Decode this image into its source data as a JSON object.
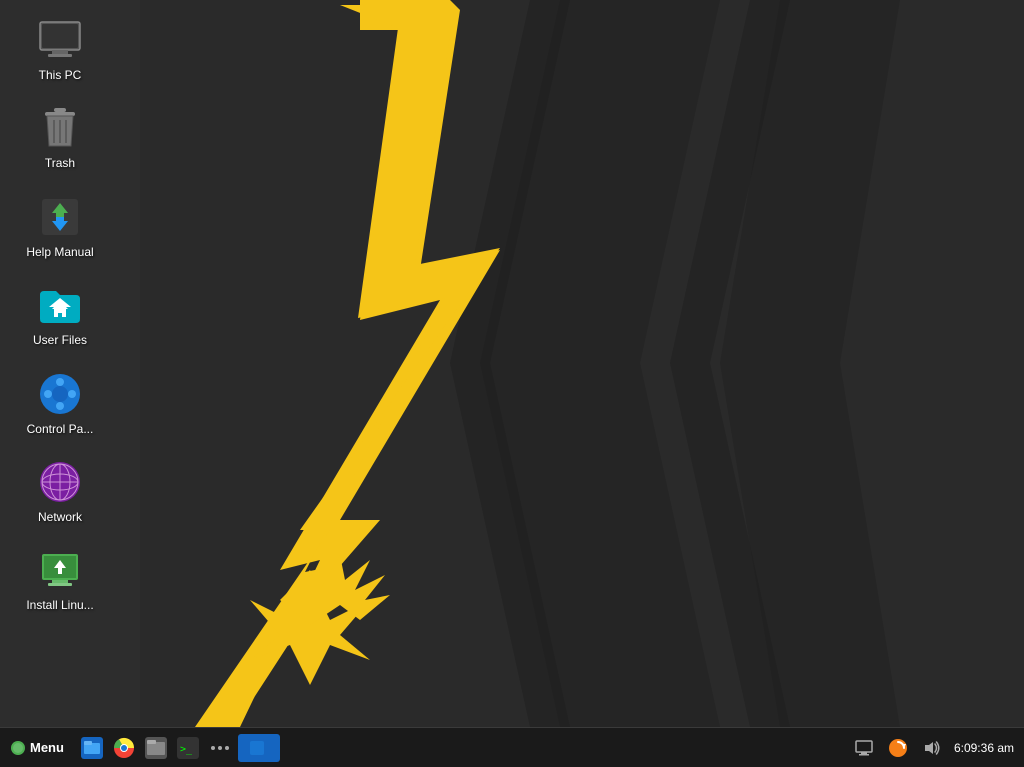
{
  "desktop": {
    "icons": [
      {
        "id": "this-pc",
        "label": "This PC",
        "icon_type": "computer"
      },
      {
        "id": "trash",
        "label": "Trash",
        "icon_type": "trash"
      },
      {
        "id": "help-manual",
        "label": "Help Manual",
        "icon_type": "help"
      },
      {
        "id": "user-files",
        "label": "User Files",
        "icon_type": "folder"
      },
      {
        "id": "control-panel",
        "label": "Control Pa...",
        "icon_type": "control-panel"
      },
      {
        "id": "network",
        "label": "Network",
        "icon_type": "network"
      },
      {
        "id": "install-linux",
        "label": "Install Linu...",
        "icon_type": "install"
      }
    ]
  },
  "taskbar": {
    "menu_label": "Menu",
    "time": "6:09:36 am",
    "apps": [
      {
        "id": "files-app",
        "icon_type": "files-blue"
      },
      {
        "id": "chrome",
        "icon_type": "chrome"
      },
      {
        "id": "file-manager",
        "icon_type": "file-manager"
      },
      {
        "id": "terminal",
        "icon_type": "terminal"
      },
      {
        "id": "menu-more",
        "icon_type": "more"
      }
    ]
  }
}
